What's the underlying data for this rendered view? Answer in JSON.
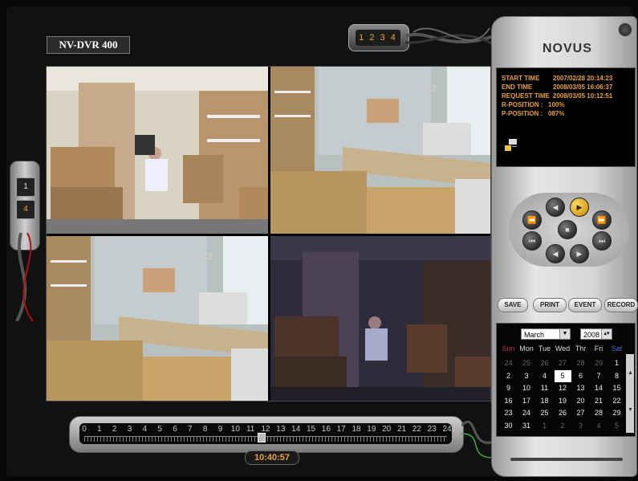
{
  "app": {
    "title": "NV-DVR 400",
    "brand": "NOVUS"
  },
  "channel_selector": {
    "label": "1 2 3 4"
  },
  "layout_buttons": [
    "1",
    "4"
  ],
  "cameras": [
    {
      "id": "cam-1",
      "label": ""
    },
    {
      "id": "cam-2",
      "label": "002"
    },
    {
      "id": "cam-3",
      "label": "002"
    },
    {
      "id": "cam-4",
      "label": ""
    }
  ],
  "info": {
    "start_time_label": "START TIME",
    "start_time": "2007/02/28 20:14:23",
    "end_time_label": "END TIME",
    "end_time": "2008/03/05 16:06:37",
    "request_time_label": "REQUEST TIME",
    "request_time": "2008/03/05 10:12:51",
    "r_position_label": "R-POSITION :",
    "r_position": "100%",
    "p_position_label": "P-POSITION :",
    "p_position": "087%"
  },
  "controls": {
    "fast_rewind": "⏪",
    "reverse": "◀",
    "play": "▶",
    "fast_forward": "⏩",
    "prev": "⏮",
    "stop": "■",
    "next": "⏭",
    "step_back": "◀",
    "step_forward": "▶"
  },
  "actions": {
    "save": "SAVE",
    "print": "PRINT",
    "event": "EVENT",
    "record": "RECORD"
  },
  "calendar": {
    "month": "March",
    "year": "2008",
    "weekdays": [
      "Sun",
      "Mon",
      "Tue",
      "Wed",
      "Thr",
      "Fri",
      "Sat"
    ],
    "weeks": [
      [
        {
          "d": "24",
          "o": true
        },
        {
          "d": "25",
          "o": true
        },
        {
          "d": "26",
          "o": true
        },
        {
          "d": "27",
          "o": true
        },
        {
          "d": "28",
          "o": true
        },
        {
          "d": "29",
          "o": true
        },
        {
          "d": "1"
        }
      ],
      [
        {
          "d": "2"
        },
        {
          "d": "3"
        },
        {
          "d": "4"
        },
        {
          "d": "5",
          "sel": true
        },
        {
          "d": "6"
        },
        {
          "d": "7"
        },
        {
          "d": "8"
        }
      ],
      [
        {
          "d": "9"
        },
        {
          "d": "10"
        },
        {
          "d": "11"
        },
        {
          "d": "12"
        },
        {
          "d": "13"
        },
        {
          "d": "14"
        },
        {
          "d": "15"
        }
      ],
      [
        {
          "d": "16"
        },
        {
          "d": "17"
        },
        {
          "d": "18"
        },
        {
          "d": "19"
        },
        {
          "d": "20"
        },
        {
          "d": "21"
        },
        {
          "d": "22"
        }
      ],
      [
        {
          "d": "23"
        },
        {
          "d": "24"
        },
        {
          "d": "25"
        },
        {
          "d": "26"
        },
        {
          "d": "27"
        },
        {
          "d": "28"
        },
        {
          "d": "29"
        }
      ],
      [
        {
          "d": "30"
        },
        {
          "d": "31"
        },
        {
          "d": "1",
          "o": true
        },
        {
          "d": "2",
          "o": true
        },
        {
          "d": "3",
          "o": true
        },
        {
          "d": "4",
          "o": true
        },
        {
          "d": "5",
          "o": true
        }
      ]
    ]
  },
  "timeline": {
    "hours": [
      "0",
      "1",
      "2",
      "3",
      "4",
      "5",
      "6",
      "7",
      "8",
      "9",
      "10",
      "11",
      "12",
      "13",
      "14",
      "15",
      "16",
      "17",
      "18",
      "19",
      "20",
      "21",
      "22",
      "23",
      "24"
    ],
    "current_time": "10:40:57"
  },
  "colors": {
    "accent": "#e8a23a",
    "sunday": "#c0392b",
    "saturday": "#4a6fd1"
  }
}
